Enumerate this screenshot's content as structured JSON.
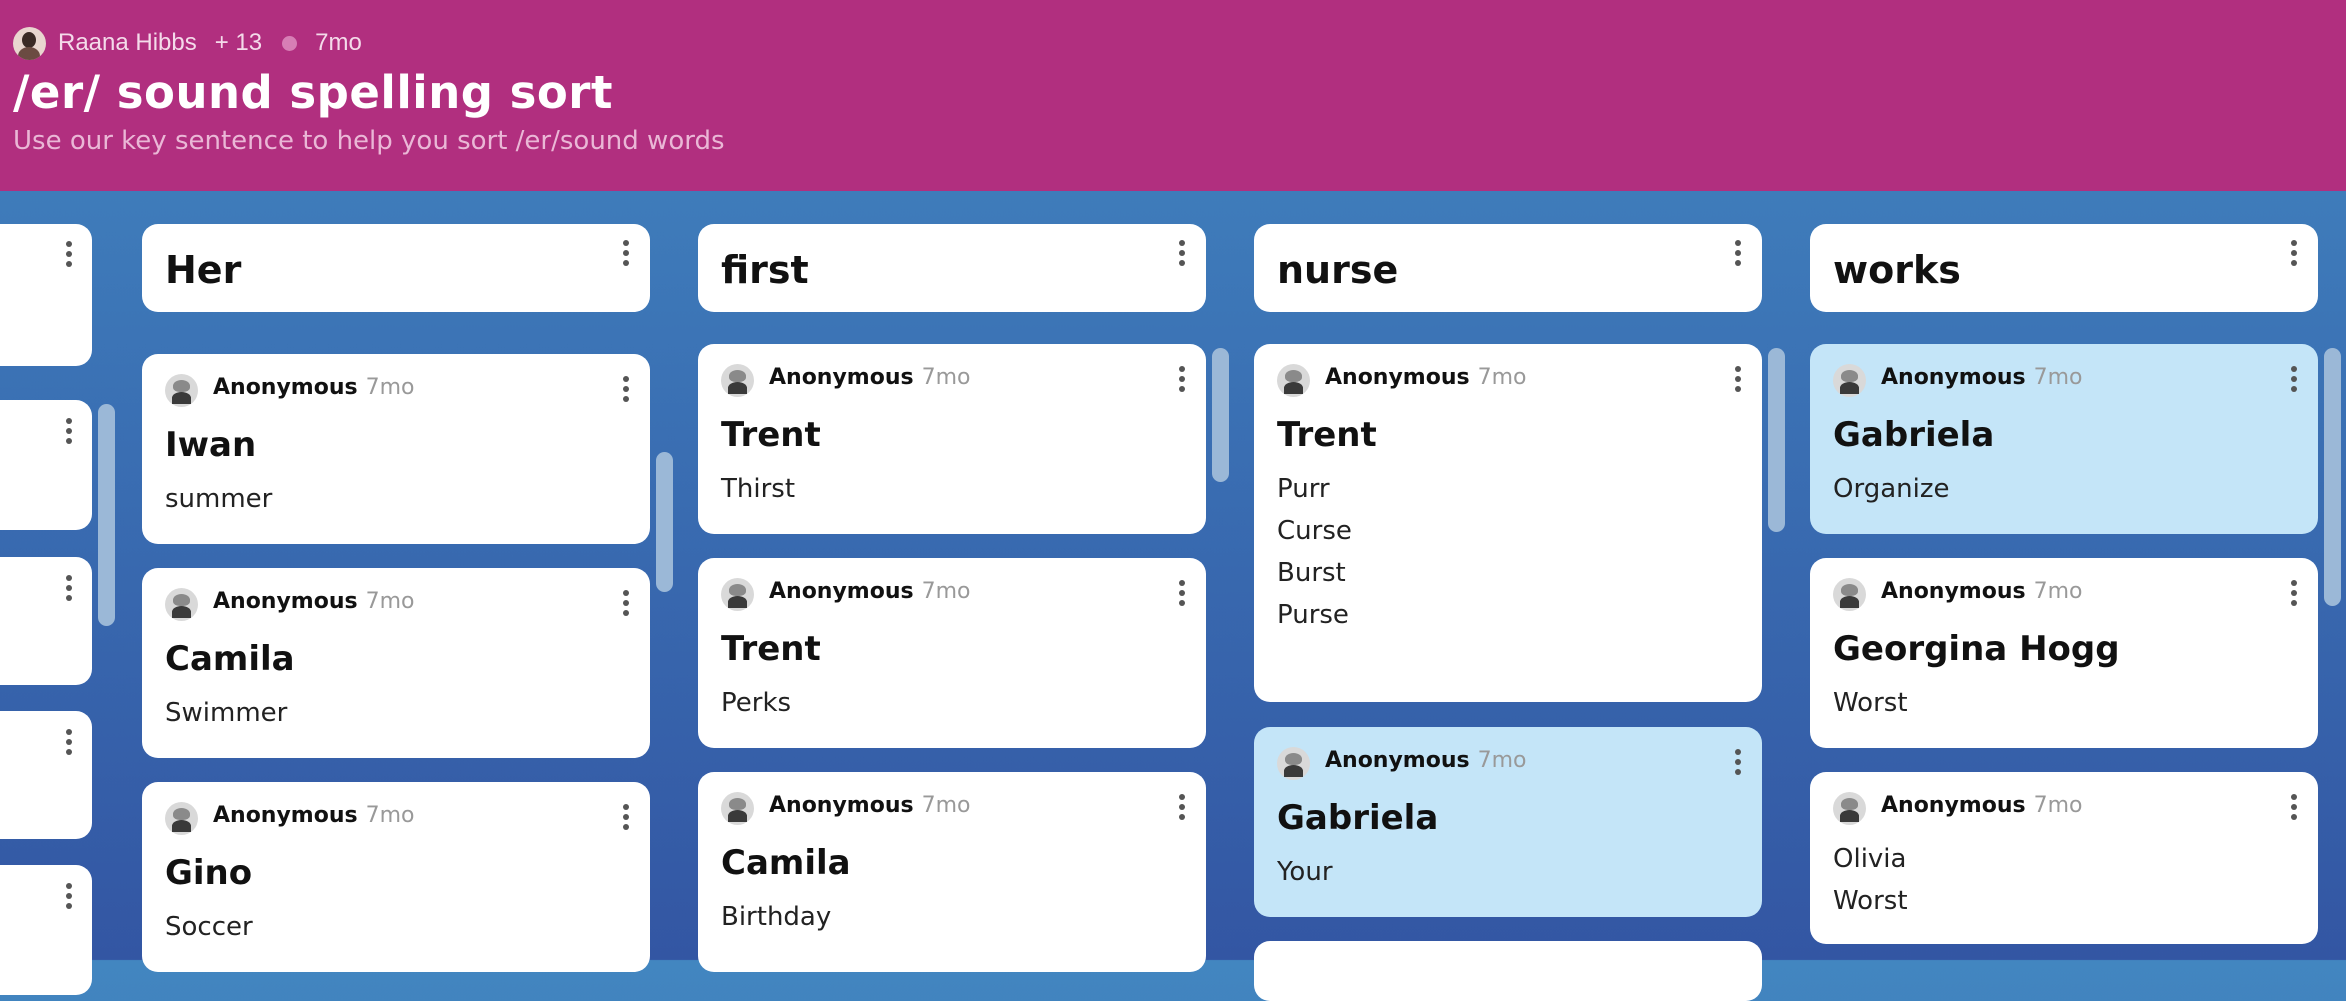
{
  "header": {
    "author": "Raana Hibbs",
    "contributors": "+ 13",
    "age": "7mo",
    "title": "/er/ sound spelling sort",
    "subtitle": "Use our key sentence to help you sort /er/sound words"
  },
  "columns": [
    {
      "name": "Her",
      "posts": [
        {
          "author": "Anonymous",
          "age": "7mo",
          "title": "Iwan",
          "body": [
            "summer"
          ]
        },
        {
          "author": "Anonymous",
          "age": "7mo",
          "title": "Camila",
          "body": [
            "Swimmer"
          ]
        },
        {
          "author": "Anonymous",
          "age": "7mo",
          "title": "Gino",
          "body": [
            "Soccer"
          ]
        }
      ]
    },
    {
      "name": "first",
      "posts": [
        {
          "author": "Anonymous",
          "age": "7mo",
          "title": "Trent",
          "body": [
            "Thirst"
          ]
        },
        {
          "author": "Anonymous",
          "age": "7mo",
          "title": "Trent",
          "body": [
            "Perks"
          ]
        },
        {
          "author": "Anonymous",
          "age": "7mo",
          "title": "Camila",
          "body": [
            "Birthday"
          ]
        }
      ]
    },
    {
      "name": "nurse",
      "posts": [
        {
          "author": "Anonymous",
          "age": "7mo",
          "title": "Trent",
          "body": [
            "Purr",
            "Curse",
            "Burst",
            "Purse"
          ]
        },
        {
          "author": "Anonymous",
          "age": "7mo",
          "title": "Gabriela",
          "body": [
            "Your"
          ],
          "highlight": true
        }
      ]
    },
    {
      "name": "works",
      "posts": [
        {
          "author": "Anonymous",
          "age": "7mo",
          "title": "Gabriela",
          "body": [
            "Organize"
          ],
          "highlight": true
        },
        {
          "author": "Anonymous",
          "age": "7mo",
          "title": "Georgina Hogg",
          "body": [
            "Worst"
          ]
        },
        {
          "author": "Anonymous",
          "age": "7mo",
          "title": "",
          "body": [
            "Olivia",
            "Worst"
          ]
        }
      ]
    }
  ],
  "colors": {
    "header": "#b12f7f",
    "background_top": "#4286c0",
    "background_bottom": "#3356a3",
    "highlight_card": "#c4e5f8"
  },
  "icons": [
    "user-avatar",
    "anonymous-avatar-icon",
    "more-options-icon"
  ]
}
